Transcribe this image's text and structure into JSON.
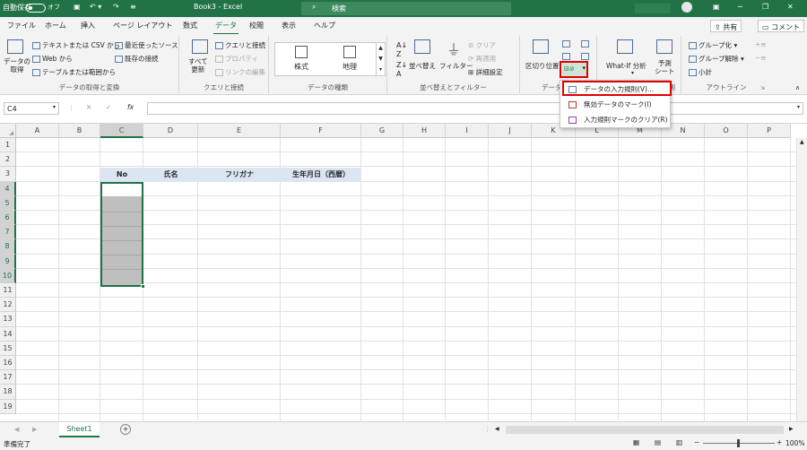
{
  "title_bar": {
    "autosave_label": "自動保存",
    "autosave_state": "オフ",
    "doc_title": "Book3  -  Excel",
    "search_placeholder": "検索"
  },
  "menu": {
    "tabs": [
      "ファイル",
      "ホーム",
      "挿入",
      "ページ レイアウト",
      "数式",
      "データ",
      "校閲",
      "表示",
      "ヘルプ"
    ],
    "active": "データ",
    "share": "共有",
    "comment": "コメント"
  },
  "ribbon": {
    "get_data": {
      "btn": "データの\n取得",
      "text_csv": "テキストまたは CSV から",
      "web": "Web から",
      "table_range": "テーブルまたは範囲から",
      "recent": "最近使ったソース",
      "existing": "既存の接続",
      "label": "データの取得と変換"
    },
    "queries": {
      "refresh": "すべて\n更新",
      "queries_conn": "クエリと接続",
      "properties": "プロパティ",
      "edit_links": "リンクの編集",
      "label": "クエリと接続"
    },
    "datatypes": {
      "stocks": "株式",
      "geo": "地理",
      "label": "データの種類"
    },
    "sort": {
      "sort": "並べ替え",
      "filter": "フィルター",
      "clear": "クリア",
      "reapply": "再適用",
      "advanced": "詳細設定",
      "label": "並べ替えとフィルター"
    },
    "tools": {
      "text_to_col": "区切り位置",
      "label": "データ ツール"
    },
    "forecast": {
      "whatif": "What-If 分析",
      "sheet": "予測\nシート",
      "label": "予測"
    },
    "outline": {
      "group": "グループ化",
      "ungroup": "グループ解除",
      "subtotal": "小計",
      "label": "アウトライン"
    }
  },
  "formula_bar": {
    "name_box": "C4",
    "fx": "fx",
    "content": ""
  },
  "columns": [
    "A",
    "B",
    "C",
    "D",
    "E",
    "F",
    "G",
    "H",
    "I",
    "J",
    "K",
    "L",
    "M",
    "N",
    "O",
    "P"
  ],
  "rows": [
    "1",
    "2",
    "3",
    "4",
    "5",
    "6",
    "7",
    "8",
    "9",
    "10",
    "11",
    "12",
    "13",
    "14",
    "15",
    "16",
    "17",
    "18",
    "19"
  ],
  "headers": [
    "No",
    "氏名",
    "フリガナ",
    "生年月日（西暦）"
  ],
  "selected_cell": "C4",
  "selected_range": "C4:C10",
  "dropdown": [
    "データの入力規則(V)...",
    "無効データのマーク(I)",
    "入力規則マークのクリア(R)"
  ],
  "sheet": {
    "tab": "Sheet1"
  },
  "status": {
    "ready": "準備完了",
    "zoom": "100%"
  },
  "colors": {
    "excel_green": "#217346",
    "header_fill": "#dce6f2",
    "selection_fill": "#bfbfbf",
    "highlight_red": "#e00000"
  }
}
